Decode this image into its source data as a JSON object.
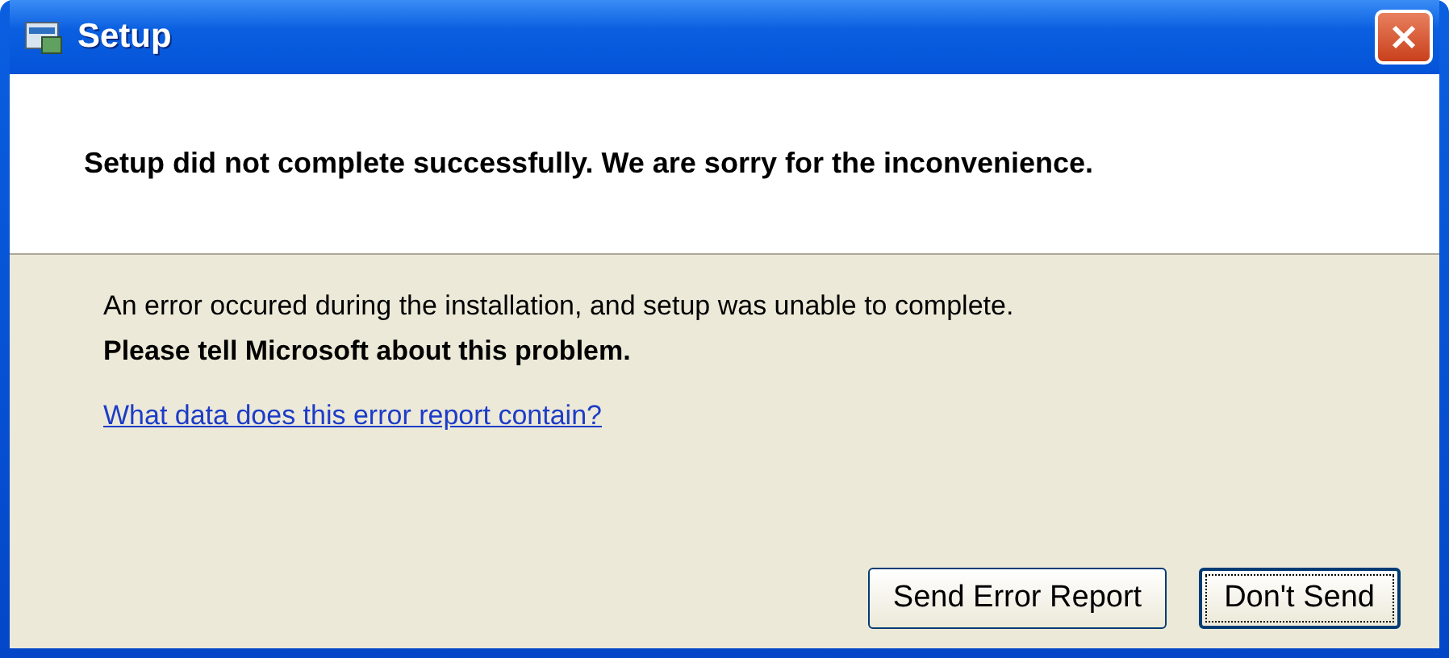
{
  "window": {
    "title": "Setup"
  },
  "header": {
    "message": "Setup did not complete successfully. We are sorry for the inconvenience."
  },
  "body": {
    "error_text": "An error occured during the installation, and setup was unable to complete.",
    "request_text": "Please tell Microsoft about this problem.",
    "link": "What data does this error report contain?"
  },
  "buttons": [
    {
      "label": "Send Error Report",
      "default": false
    },
    {
      "label": "Don't Send",
      "default": true
    }
  ]
}
